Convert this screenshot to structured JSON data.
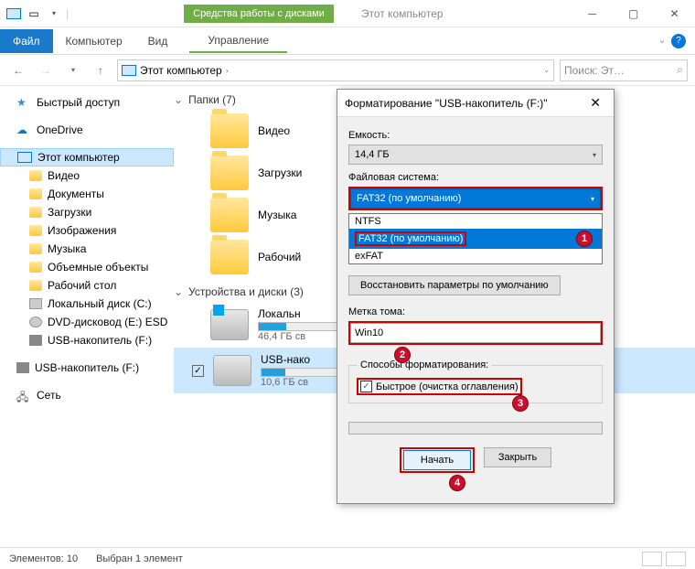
{
  "window": {
    "ctx_tab": "Средства работы с дисками",
    "title": "Этот компьютер"
  },
  "ribbon": {
    "file": "Файл",
    "tabs": [
      "Компьютер",
      "Вид"
    ],
    "ctx": "Управление"
  },
  "address": {
    "location": "Этот компьютер",
    "search_placeholder": "Поиск: Эт…"
  },
  "sidebar": {
    "quick": "Быстрый доступ",
    "onedrive": "OneDrive",
    "thispc": "Этот компьютер",
    "items": [
      "Видео",
      "Документы",
      "Загрузки",
      "Изображения",
      "Музыка",
      "Объемные объекты",
      "Рабочий стол",
      "Локальный диск (C:)",
      "DVD-дисковод (E:) ESD",
      "USB-накопитель (F:)"
    ],
    "usb2": "USB-накопитель (F:)",
    "network": "Сеть"
  },
  "main": {
    "folders_hdr": "Папки (7)",
    "folders": [
      "Видео",
      "Загрузки",
      "Музыка",
      "Рабочий"
    ],
    "devices_hdr": "Устройства и диски (3)",
    "local": {
      "name": "Локальн",
      "free": "46,4 ГБ св",
      "fill": 28
    },
    "usb": {
      "name": "USB-нако",
      "free": "10,6 ГБ св",
      "fill": 24
    }
  },
  "status": {
    "count": "Элементов: 10",
    "sel": "Выбран 1 элемент"
  },
  "dialog": {
    "title": "Форматирование \"USB-накопитель (F:)\"",
    "capacity_label": "Емкость:",
    "capacity_value": "14,4 ГБ",
    "fs_label": "Файловая система:",
    "fs_selected": "FAT32 (по умолчанию)",
    "fs_options": [
      "NTFS",
      "FAT32 (по умолчанию)",
      "exFAT"
    ],
    "restore_btn": "Восстановить параметры по умолчанию",
    "volume_label": "Метка тома:",
    "volume_value": "Win10",
    "methods_label": "Способы форматирования:",
    "quick_label": "Быстрое (очистка оглавления)",
    "start_btn": "Начать",
    "close_btn": "Закрыть"
  },
  "callouts": [
    "1",
    "2",
    "3",
    "4"
  ]
}
